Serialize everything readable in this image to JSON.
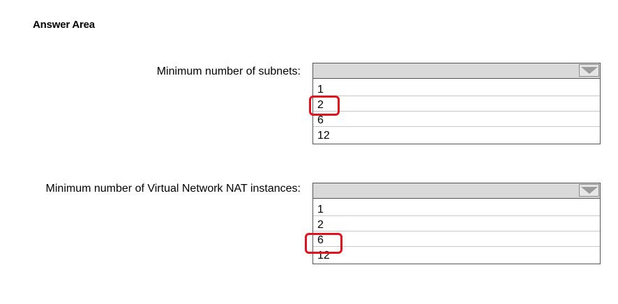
{
  "answer_area": {
    "title": "Answer Area"
  },
  "questions": [
    {
      "label": "Minimum number of subnets:",
      "options": [
        "1",
        "2",
        "6",
        "12"
      ],
      "selected": "2"
    },
    {
      "label": "Minimum number of Virtual Network NAT instances:",
      "options": [
        "1",
        "2",
        "6",
        "12"
      ],
      "selected": "6"
    }
  ],
  "icons": {
    "dropdown_arrow": "chevron-down-icon"
  },
  "colors": {
    "highlight": "#e0141e",
    "header_bg": "#d9d9d9"
  }
}
